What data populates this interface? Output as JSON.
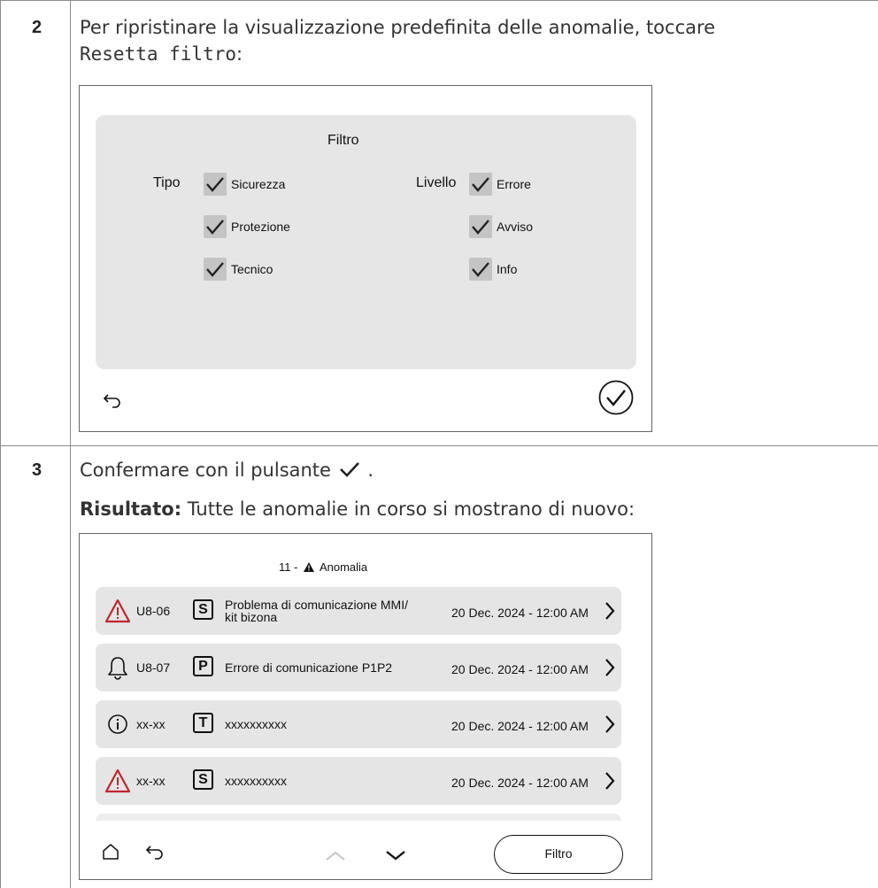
{
  "steps": [
    {
      "number": "2",
      "text_before": "Per ripristinare la visualizzazione predefinita delle anomalie, toccare",
      "code": "Resetta filtro",
      "text_after": ":"
    },
    {
      "number": "3",
      "text_before": "Confermare con il pulsante",
      "text_after": ".",
      "result_label": "Risultato:",
      "result_text": "Tutte le anomalie in corso si mostrano di nuovo:"
    }
  ],
  "filter_screen": {
    "title": "Filtro",
    "tipo_label": "Tipo",
    "livello_label": "Livello",
    "tipo_options": [
      {
        "label": "Sicurezza",
        "checked": true
      },
      {
        "label": "Protezione",
        "checked": true
      },
      {
        "label": "Tecnico",
        "checked": true
      }
    ],
    "livello_options": [
      {
        "label": "Errore",
        "checked": true
      },
      {
        "label": "Avviso",
        "checked": true
      },
      {
        "label": "Info",
        "checked": true
      }
    ],
    "back_icon": "back-arrow-icon",
    "confirm_icon": "check-circle-icon"
  },
  "fault_screen": {
    "title_prefix": "11 -",
    "title_icon": "warning-triangle-icon",
    "title_text": "Anomalia",
    "rows": [
      {
        "icon": "warning-triangle-red-icon",
        "code": "U8-06",
        "type": "S",
        "desc_line1": "Problema di comunicazione MMI/",
        "desc_line2": "kit bizona",
        "date": "20 Dec. 2024 - 12:00 AM"
      },
      {
        "icon": "bell-icon",
        "code": "U8-07",
        "type": "P",
        "desc_line1": "Errore di comunicazione P1P2",
        "desc_line2": "",
        "date": "20 Dec. 2024 - 12:00 AM"
      },
      {
        "icon": "info-circle-icon",
        "code": "xx-xx",
        "type": "T",
        "desc_line1": "xxxxxxxxxx",
        "desc_line2": "",
        "date": "20 Dec. 2024 - 12:00 AM"
      },
      {
        "icon": "warning-triangle-red-icon",
        "code": "xx-xx",
        "type": "S",
        "desc_line1": "xxxxxxxxxx",
        "desc_line2": "",
        "date": "20 Dec. 2024 - 12:00 AM"
      }
    ],
    "filter_button": "Filtro",
    "home_icon": "home-icon",
    "back_icon": "back-arrow-icon",
    "up_icon": "chevron-up-icon",
    "down_icon": "chevron-down-icon"
  }
}
